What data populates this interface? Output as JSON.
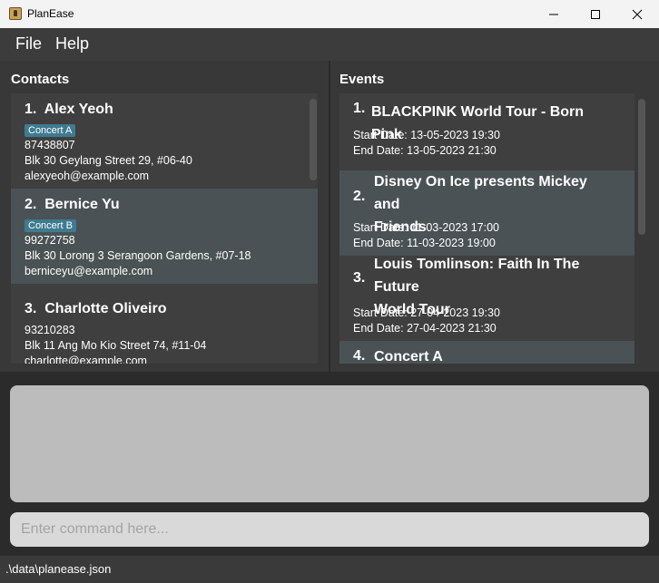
{
  "window": {
    "title": "PlanEase"
  },
  "menu": {
    "file": "File",
    "help": "Help"
  },
  "contacts": {
    "heading": "Contacts",
    "items": [
      {
        "index": "1.",
        "name": "Alex Yeoh",
        "tag": "Concert A",
        "phone": "87438807",
        "address": "Blk 30 Geylang Street 29, #06-40",
        "email": "alexyeoh@example.com"
      },
      {
        "index": "2.",
        "name": "Bernice Yu",
        "tag": "Concert B",
        "phone": "99272758",
        "address": "Blk 30 Lorong 3 Serangoon Gardens, #07-18",
        "email": "berniceyu@example.com"
      },
      {
        "index": "3.",
        "name": "Charlotte Oliveiro",
        "tag": "",
        "phone": "93210283",
        "address": "Blk 11 Ang Mo Kio Street 74, #11-04",
        "email": "charlotte@example.com"
      }
    ]
  },
  "events": {
    "heading": "Events",
    "items": [
      {
        "index": "1.",
        "title_line1": "BLACKPINK World Tour - Born Pink",
        "title_line2": "",
        "start": "Start Date: 13-05-2023 19:30",
        "end": "End Date: 13-05-2023 21:30"
      },
      {
        "index": "2.",
        "title_line1": "Disney On Ice presents Mickey and",
        "title_line2": "Friends",
        "start": "Start Date: 11-03-2023 17:00",
        "end": "End Date: 11-03-2023 19:00"
      },
      {
        "index": "3.",
        "title_line1": "Louis Tomlinson: Faith In The Future",
        "title_line2": "World Tour",
        "start": "Start Date: 27-04-2023 19:30",
        "end": "End Date: 27-04-2023 21:30"
      },
      {
        "index": "4.",
        "title_line1": "Concert A",
        "title_line2": "",
        "start": "",
        "end": ""
      }
    ]
  },
  "command": {
    "placeholder": "Enter command here..."
  },
  "status": {
    "path": ".\\data\\planease.json"
  },
  "colors": {
    "tag": "#3e7b91",
    "selected_row": "#4a5255",
    "background": "#2b2b2b"
  }
}
